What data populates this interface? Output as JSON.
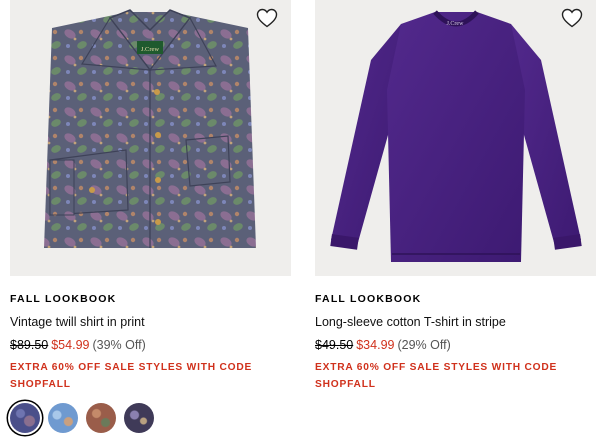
{
  "products": [
    {
      "eyebrow": "Fall Lookbook",
      "name": "Vintage twill shirt in print",
      "price_original": "$89.50",
      "price_sale": "$54.99",
      "price_off": "(39% Off)",
      "promo_line1": "Extra 60% off sale styles with code",
      "promo_line2": "SHOPFALL",
      "image_colors": {
        "base": "#5a5f7a",
        "accent": "#8a6f8f",
        "label": "#1f5a2e"
      },
      "swatches": [
        {
          "name": "navy paisley",
          "color": "#4a4f8a",
          "selected": true
        },
        {
          "name": "blue paisley",
          "color": "#6f9ad0",
          "selected": false
        },
        {
          "name": "rust paisley",
          "color": "#9a5d4a",
          "selected": false
        },
        {
          "name": "dark paisley",
          "color": "#3f3a58",
          "selected": false
        }
      ]
    },
    {
      "eyebrow": "Fall Lookbook",
      "name": "Long-sleeve cotton T-shirt in stripe",
      "price_original": "$49.50",
      "price_sale": "$34.99",
      "price_off": "(29% Off)",
      "promo_line1": "Extra 60% off sale styles with code",
      "promo_line2": "SHOPFALL",
      "image_colors": {
        "base": "#4a2380",
        "shade": "#38186a"
      }
    }
  ],
  "icons": {
    "favorite": "heart-outline-icon"
  }
}
